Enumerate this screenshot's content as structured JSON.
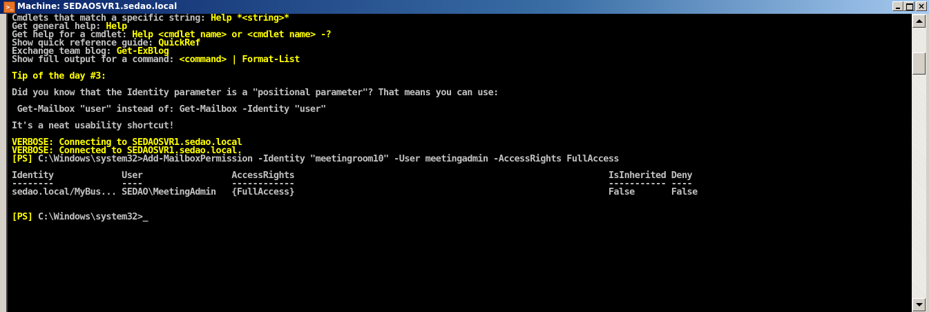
{
  "window": {
    "title": "Machine: SEDAOSVR1.sedao.local",
    "icon": "powershell-icon",
    "buttons": {
      "minimize": "minimize",
      "maximize": "maximize",
      "close": "×"
    }
  },
  "console": {
    "colors": {
      "background": "#000000",
      "text": "#c0c0c0",
      "highlight": "#ffff00"
    },
    "lines": [
      {
        "segs": [
          {
            "t": "Cmdlets that match a specific string: ",
            "c": "w"
          },
          {
            "t": "Help *<string>*",
            "c": "y"
          }
        ]
      },
      {
        "segs": [
          {
            "t": "Get general help: ",
            "c": "w"
          },
          {
            "t": "Help",
            "c": "y"
          }
        ]
      },
      {
        "segs": [
          {
            "t": "Get help for a cmdlet: ",
            "c": "w"
          },
          {
            "t": "Help <cmdlet name> or <cmdlet name> -?",
            "c": "y"
          }
        ]
      },
      {
        "segs": [
          {
            "t": "Show quick reference guide: ",
            "c": "w"
          },
          {
            "t": "QuickRef",
            "c": "y"
          }
        ]
      },
      {
        "segs": [
          {
            "t": "Exchange team blog: ",
            "c": "w"
          },
          {
            "t": "Get-ExBlog",
            "c": "y"
          }
        ]
      },
      {
        "segs": [
          {
            "t": "Show full output for a command: ",
            "c": "w"
          },
          {
            "t": "<command> | Format-List",
            "c": "y"
          }
        ]
      },
      {
        "segs": [
          {
            "t": "",
            "c": "w"
          }
        ]
      },
      {
        "segs": [
          {
            "t": "Tip of the day #3:",
            "c": "y"
          }
        ]
      },
      {
        "segs": [
          {
            "t": "",
            "c": "w"
          }
        ]
      },
      {
        "segs": [
          {
            "t": "Did you know that the Identity parameter is a \"positional parameter\"? That means you can use:",
            "c": "w"
          }
        ]
      },
      {
        "segs": [
          {
            "t": "",
            "c": "w"
          }
        ]
      },
      {
        "segs": [
          {
            "t": " Get-Mailbox \"user\" instead of: Get-Mailbox -Identity \"user\"",
            "c": "w"
          }
        ]
      },
      {
        "segs": [
          {
            "t": "",
            "c": "w"
          }
        ]
      },
      {
        "segs": [
          {
            "t": "It's a neat usability shortcut!",
            "c": "w"
          }
        ]
      },
      {
        "segs": [
          {
            "t": "",
            "c": "w"
          }
        ]
      },
      {
        "segs": [
          {
            "t": "VERBOSE: Connecting to SEDAOSVR1.sedao.local",
            "c": "y"
          }
        ]
      },
      {
        "segs": [
          {
            "t": "VERBOSE: Connected to SEDAOSVR1.sedao.local.",
            "c": "y"
          }
        ]
      },
      {
        "segs": [
          {
            "t": "[PS] ",
            "c": "y"
          },
          {
            "t": "C:\\Windows\\system32>Add-MailboxPermission -Identity \"meetingroom10\" -User meetingadmin -AccessRights FullAccess",
            "c": "w"
          }
        ]
      },
      {
        "segs": [
          {
            "t": "",
            "c": "w"
          }
        ]
      },
      {
        "segs": [
          {
            "t": "Identity             User                 AccessRights                                                            IsInherited Deny",
            "c": "w"
          }
        ]
      },
      {
        "segs": [
          {
            "t": "--------             ----                 ------------                                                            ----------- ----",
            "c": "w"
          }
        ]
      },
      {
        "segs": [
          {
            "t": "sedao.local/MyBus... SEDAO\\MeetingAdmin   {FullAccess}                                                            False       False",
            "c": "w"
          }
        ]
      },
      {
        "segs": [
          {
            "t": "",
            "c": "w"
          }
        ]
      },
      {
        "segs": [
          {
            "t": "",
            "c": "w"
          }
        ]
      },
      {
        "segs": [
          {
            "t": "[PS] ",
            "c": "y"
          },
          {
            "t": "C:\\Windows\\system32>",
            "c": "w"
          },
          {
            "t": "_",
            "c": "w"
          }
        ]
      }
    ]
  },
  "scrollbar": {
    "up_icon": "arrow-up-icon",
    "down_icon": "arrow-down-icon"
  }
}
